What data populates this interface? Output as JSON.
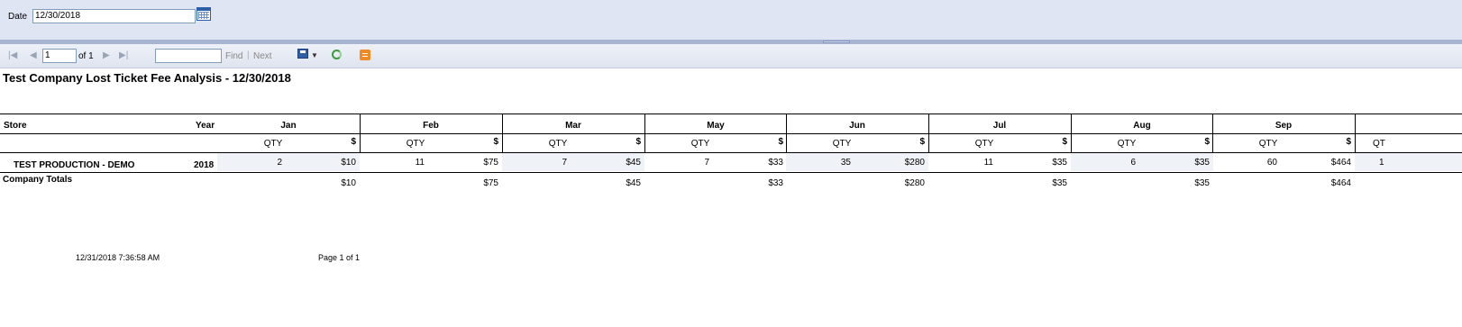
{
  "params": {
    "date_label": "Date",
    "date_value": "12/30/2018"
  },
  "toolbar": {
    "page_value": "1",
    "of_label": "of 1",
    "find_label": "Find",
    "separator": "|",
    "next_label": "Next",
    "icons": [
      "first-page-icon",
      "previous-page-icon",
      "next-page-icon",
      "last-page-icon",
      "export-icon",
      "refresh-icon",
      "rss-feed-icon"
    ]
  },
  "report": {
    "title": "Test Company Lost Ticket Fee Analysis - 12/30/2018",
    "store_header": "Store",
    "year_header": "Year",
    "months": [
      "Jan",
      "Feb",
      "Mar",
      "May",
      "Jun",
      "Jul",
      "Aug",
      "Sep"
    ],
    "partial_qty_header": "QT",
    "qty_label": "QTY",
    "amount_label": "$",
    "row": {
      "store": "TEST PRODUCTION - DEMO",
      "year": "2018",
      "values": [
        {
          "qty": "2",
          "amount": "$10"
        },
        {
          "qty": "11",
          "amount": "$75"
        },
        {
          "qty": "7",
          "amount": "$45"
        },
        {
          "qty": "7",
          "amount": "$33"
        },
        {
          "qty": "35",
          "amount": "$280"
        },
        {
          "qty": "11",
          "amount": "$35"
        },
        {
          "qty": "6",
          "amount": "$35"
        },
        {
          "qty": "60",
          "amount": "$464"
        }
      ],
      "partial_qty": "1"
    },
    "totals": {
      "label": "Company Totals",
      "amounts": [
        "$10",
        "$75",
        "$45",
        "$33",
        "$280",
        "$35",
        "$35",
        "$464"
      ]
    }
  },
  "footer": {
    "timestamp": "12/31/2018 7:36:58 AM",
    "page": "Page 1 of 1"
  }
}
